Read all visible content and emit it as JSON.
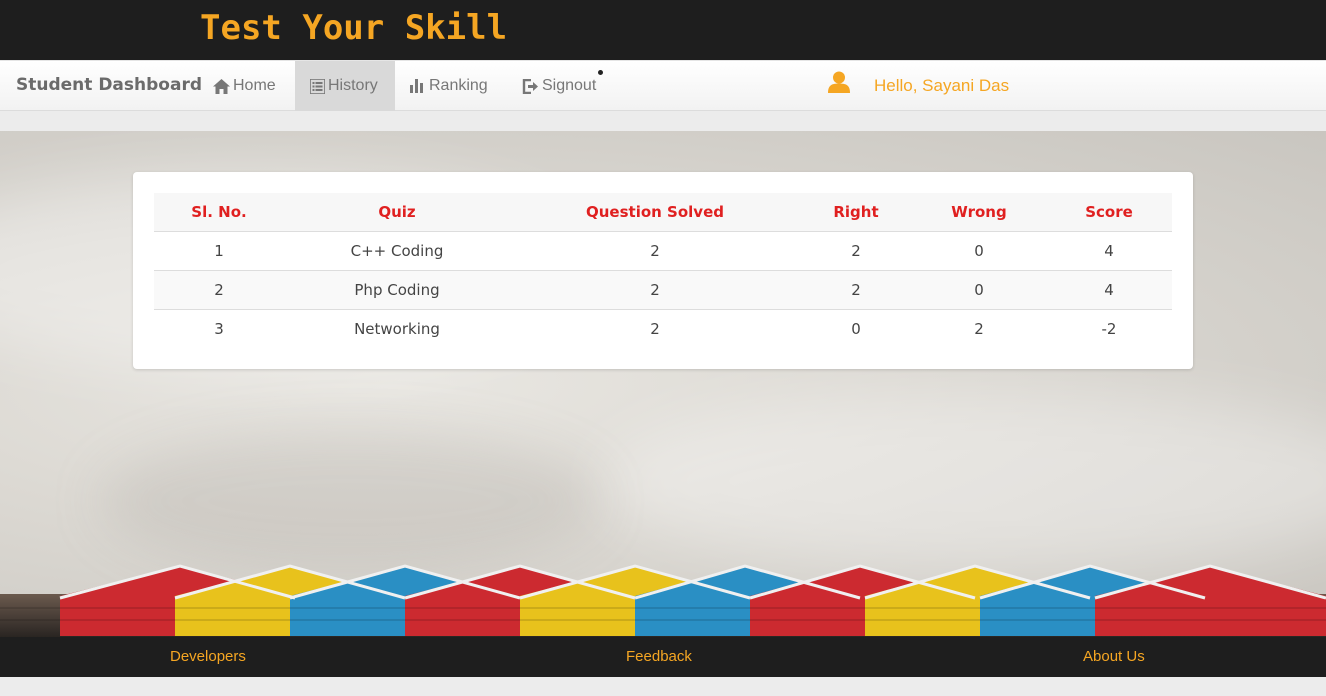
{
  "header": {
    "logo": "Test Your Skill"
  },
  "navbar": {
    "brand": "Student Dashboard",
    "items": [
      {
        "label": "Home",
        "icon": "home-icon"
      },
      {
        "label": "History",
        "icon": "list-icon",
        "active": true
      },
      {
        "label": "Ranking",
        "icon": "bar-chart-icon"
      },
      {
        "label": "Signout",
        "icon": "signout-icon"
      }
    ],
    "greeting": "Hello, Sayani Das"
  },
  "history": {
    "columns": [
      "Sl. No.",
      "Quiz",
      "Question Solved",
      "Right",
      "Wrong",
      "Score"
    ],
    "rows": [
      [
        "1",
        "C++ Coding",
        "2",
        "2",
        "0",
        "4"
      ],
      [
        "2",
        "Php Coding",
        "2",
        "2",
        "0",
        "4"
      ],
      [
        "3",
        "Networking",
        "2",
        "0",
        "2",
        "-2"
      ]
    ]
  },
  "footer": {
    "links": [
      "Developers",
      "Feedback",
      "About Us"
    ]
  },
  "colors": {
    "accent": "#f5a623",
    "header_red": "#e02020",
    "dark": "#1e1e1e"
  }
}
